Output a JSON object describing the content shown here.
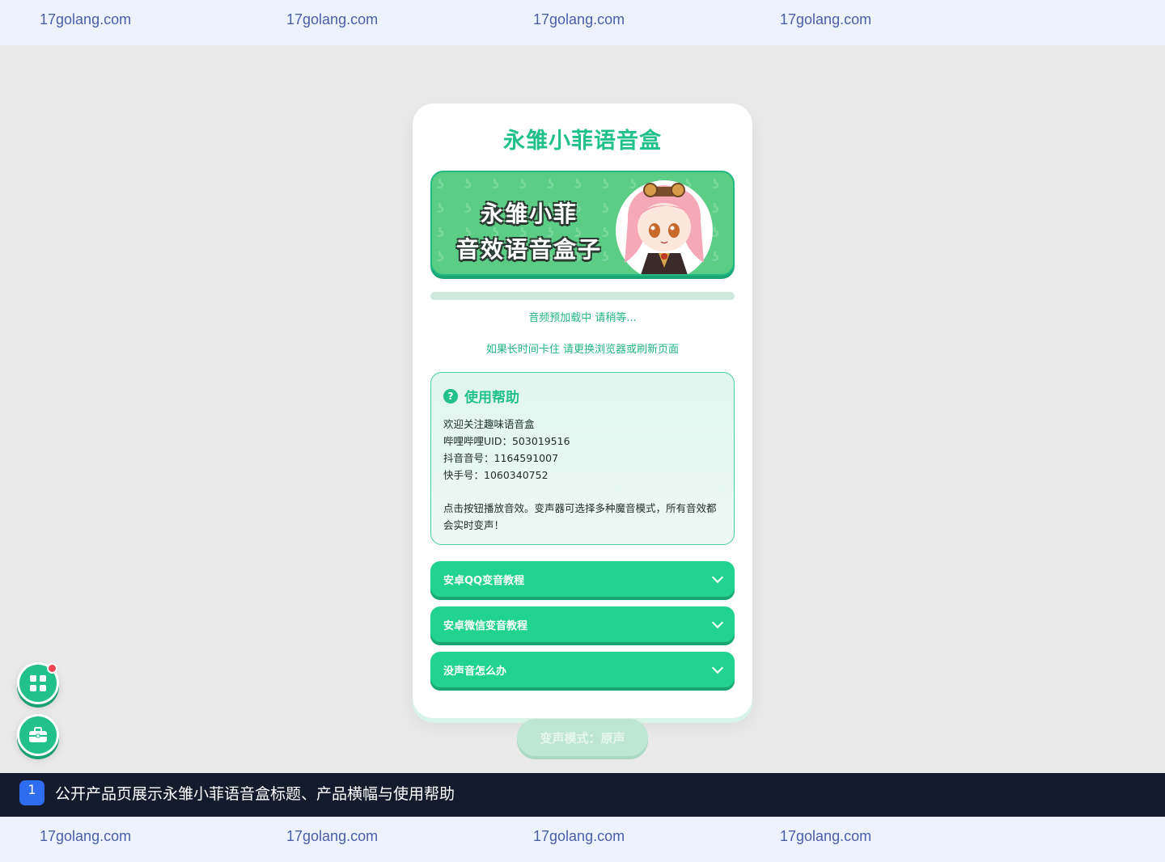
{
  "watermark": {
    "text": "17golang.com"
  },
  "app": {
    "title": "永雏小菲语音盒"
  },
  "banner": {
    "line1": "永雏小菲",
    "line2": "音效语音盒子"
  },
  "loading": {
    "progress": 0,
    "status": "音频预加载中 请稍等...",
    "hint": "如果长时间卡住 请更换浏览器或刷新页面"
  },
  "help": {
    "icon": "question-icon",
    "title": "使用帮助",
    "lines": [
      "欢迎关注趣味语音盒",
      "哔哩哔哩UID：503019516",
      "抖音音号：1164591007",
      "快手号：1060340752"
    ],
    "instruction": "点击按钮播放音效。变声器可选择多种魔音模式，所有音效都会实时变声！"
  },
  "accordions": [
    {
      "label": "安卓QQ变音教程"
    },
    {
      "label": "安卓微信变音教程"
    },
    {
      "label": "没声音怎么办"
    }
  ],
  "mode_button": {
    "label": "变声模式：原声"
  },
  "fabs": {
    "menu_icon": "grid-icon",
    "tools_icon": "toolbox-icon"
  },
  "caption": {
    "number": "1",
    "text": "公开产品页展示永雏小菲语音盒标题、产品横幅与使用帮助"
  },
  "colors": {
    "accent": "#22c08a",
    "button": "#22d38f",
    "caption_bg": "#141b2d"
  }
}
